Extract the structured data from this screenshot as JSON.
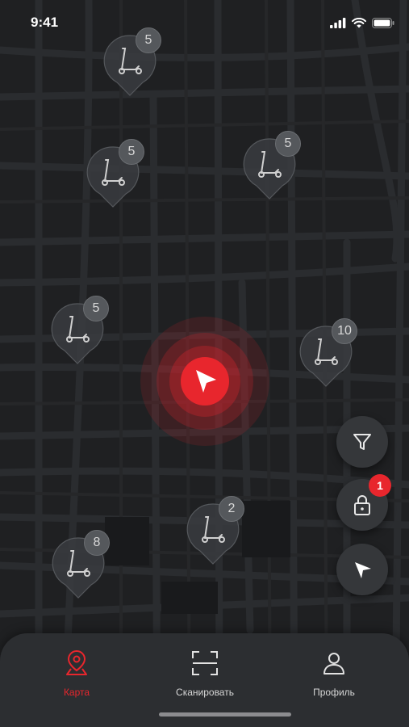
{
  "status_bar": {
    "time": "9:41"
  },
  "map": {
    "scooter_pins": [
      {
        "count": "5"
      },
      {
        "count": "5"
      },
      {
        "count": "5"
      },
      {
        "count": "5"
      },
      {
        "count": "10"
      },
      {
        "count": "2"
      },
      {
        "count": "8"
      }
    ]
  },
  "controls": {
    "filter_icon": "filter-icon",
    "lock_icon": "lock-icon",
    "lock_badge": "1",
    "locate_icon": "navigation-arrow-icon"
  },
  "tabbar": {
    "tabs": [
      {
        "label": "Карта",
        "icon": "map-pin-icon",
        "active": true
      },
      {
        "label": "Сканировать",
        "icon": "scan-icon",
        "active": false
      },
      {
        "label": "Профиль",
        "icon": "profile-icon",
        "active": false
      }
    ]
  },
  "colors": {
    "accent": "#e8262d",
    "map_bg": "#1f2022",
    "road": "#2a2b2e",
    "panel": "#2c2e31"
  }
}
